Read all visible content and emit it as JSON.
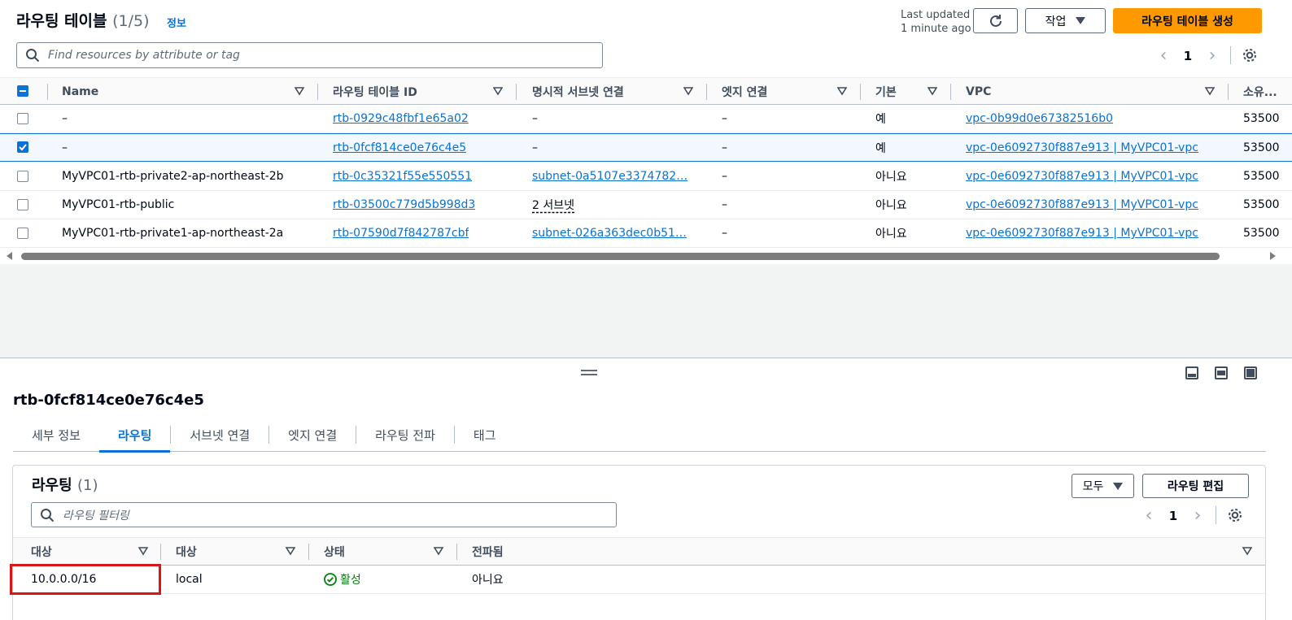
{
  "header": {
    "title": "라우팅 테이블",
    "count": "(1/5)",
    "info_link": "정보",
    "last_updated_line1": "Last updated",
    "last_updated_line2": "1 minute ago",
    "action_button": "작업",
    "create_button": "라우팅 테이블 생성"
  },
  "search": {
    "placeholder": "Find resources by attribute or tag"
  },
  "pagination": {
    "page": "1"
  },
  "table": {
    "columns": [
      "Name",
      "라우팅 테이블 ID",
      "명시적 서브넷 연결",
      "엣지 연결",
      "기본",
      "VPC",
      "소유..."
    ],
    "rows": [
      {
        "selected": false,
        "name": "–",
        "id": "rtb-0929c48fbf1e65a02",
        "subnet": "–",
        "edge": "–",
        "main": "예",
        "vpc": "vpc-0b99d0e67382516b0",
        "owner": "53500"
      },
      {
        "selected": true,
        "name": "–",
        "id": "rtb-0fcf814ce0e76c4e5",
        "subnet": "–",
        "edge": "–",
        "main": "예",
        "vpc": "vpc-0e6092730f887e913 | MyVPC01-vpc",
        "owner": "53500"
      },
      {
        "selected": false,
        "name": "MyVPC01-rtb-private2-ap-northeast-2b",
        "id": "rtb-0c35321f55e550551",
        "subnet": "subnet-0a5107e3374782…",
        "edge": "–",
        "main": "아니요",
        "vpc": "vpc-0e6092730f887e913 | MyVPC01-vpc",
        "owner": "53500"
      },
      {
        "selected": false,
        "name": "MyVPC01-rtb-public",
        "id": "rtb-03500c779d5b998d3",
        "subnet": "2 서브넷",
        "edge": "–",
        "main": "아니요",
        "vpc": "vpc-0e6092730f887e913 | MyVPC01-vpc",
        "owner": "53500"
      },
      {
        "selected": false,
        "name": "MyVPC01-rtb-private1-ap-northeast-2a",
        "id": "rtb-07590d7f842787cbf",
        "subnet": "subnet-026a363dec0b51…",
        "edge": "–",
        "main": "아니요",
        "vpc": "vpc-0e6092730f887e913 | MyVPC01-vpc",
        "owner": "53500"
      }
    ]
  },
  "detail": {
    "title": "rtb-0fcf814ce0e76c4e5",
    "tabs": [
      "세부 정보",
      "라우팅",
      "서브넷 연결",
      "엣지 연결",
      "라우팅 전파",
      "태그"
    ],
    "active_tab": "라우팅",
    "routes": {
      "title": "라우팅",
      "count": "(1)",
      "filter_button": "모두",
      "edit_button": "라우팅 편집",
      "search_placeholder": "라우팅 필터링",
      "page": "1",
      "columns": [
        "대상",
        "대상",
        "상태",
        "전파됨"
      ],
      "rows": [
        {
          "destination": "10.0.0.0/16",
          "target": "local",
          "status": "활성",
          "propagated": "아니요"
        }
      ]
    }
  },
  "colors": {
    "accent": "#0972d3",
    "primary_button": "#ff9900",
    "active_status": "#037f0c",
    "highlight_box": "#d91515"
  }
}
